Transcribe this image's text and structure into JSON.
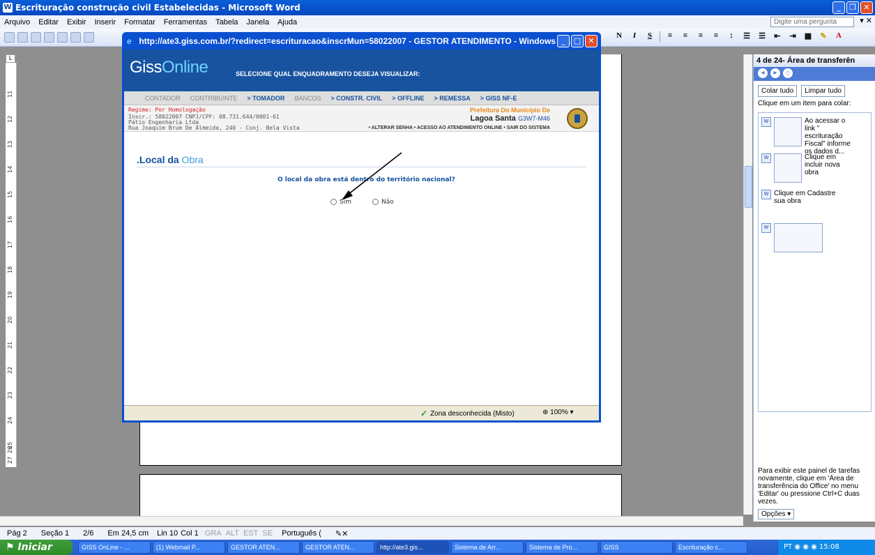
{
  "word": {
    "title": "Escrituração construção civil Estabelecidas - Microsoft Word",
    "menu": [
      "Arquivo",
      "Editar",
      "Exibir",
      "Inserir",
      "Formatar",
      "Ferramentas",
      "Tabela",
      "Janela",
      "Ajuda"
    ],
    "help_placeholder": "Digite uma pergunta",
    "format_buttons": [
      "N",
      "I",
      "S"
    ],
    "ruler_numbers": [
      "11",
      "12",
      "13",
      "14",
      "15",
      "16",
      "17",
      "18",
      "19",
      "20",
      "21",
      "22",
      "23",
      "24",
      "25",
      "26",
      "27"
    ],
    "status": {
      "page": "Pág 2",
      "section": "Seção 1",
      "pages": "2/6",
      "position": "Em 24,5 cm",
      "line": "Lin 10",
      "col": "Col 1",
      "modes": [
        "GRA",
        "ALT",
        "EST",
        "SE"
      ],
      "language": "Português ("
    }
  },
  "taskpane": {
    "title": "4 de 24- Área de transferên",
    "paste_all": "Colar tudo",
    "clear_all": "Limpar tudo",
    "hint": "Clique em um item para colar:",
    "items": [
      "Ao acessar o link \" escrituração Fiscal\" informe os dados d...",
      "Clique em incluir nova obra",
      "Clique em Cadastre sua obra"
    ],
    "footer": "Para exibir este painel de tarefas novamente, clique em 'Área de transferência do Office' no menu 'Editar' ou pressione Ctrl+C duas vezes.",
    "options": "Opções"
  },
  "ie": {
    "title": "http://ate3.giss.com.br/?redirect=escrituracao&inscrMun=58022007 - GESTOR ATENDIMENTO - Windows Int...",
    "zone": "Zona desconhecida (Misto)",
    "zoom": "100%"
  },
  "giss": {
    "logo_a": "Giss",
    "logo_b": "Online",
    "tagline": "SELECIONE QUAL ENQUADRAMENTO DESEJA VISUALIZAR:",
    "nav": [
      "CONTADOR",
      "CONTRIBUINTE",
      "> TOMADOR",
      "BANCOS",
      "> CONSTR. CIVIL",
      "> OFFLINE",
      "> REMESSA",
      "> GISS NF-E"
    ],
    "regime": "Regime: Por Homologação",
    "inscr": "Inscr.: 58022007   CNPJ/CPF: 08.731.644/0001-61",
    "company": "Pátio Engenharia Ltda",
    "address": "Rua Joaquim Brum De Almeida, 240 - Conj. Bela Vista",
    "pref": "Prefeitura Do Município De",
    "city": "Lagoa Santa",
    "city_code": "G3W7-M46",
    "links": "• ALTERAR SENHA  • ACESSO AO ATENDIMENTO ONLINE  • SAIR DO SISTEMA",
    "section_a": ".Local da ",
    "section_b": "Obra",
    "question": "O local da obra está dentro do território nacional?",
    "opt_yes": "Sim",
    "opt_no": "Não"
  },
  "taskbar": {
    "start": "Iniciar",
    "tasks": [
      "GISS OnLine - ...",
      "(1) Webmail P...",
      "GESTOR ATEN...",
      "GESTOR ATEN...",
      "http://ate3.gis...",
      "Sistema de Arr...",
      "Sistema de Pro...",
      "GISS",
      "Escrituração c..."
    ],
    "lang": "PT",
    "clock": "15:08"
  }
}
